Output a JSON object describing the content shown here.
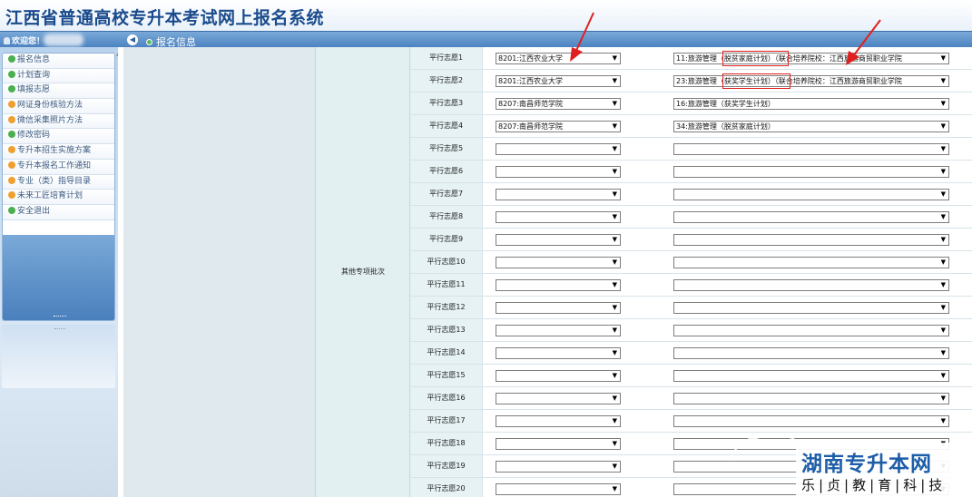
{
  "app": {
    "title": "江西省普通高校专升本考试网上报名系统"
  },
  "topbar": {
    "welcome": "欢迎您！",
    "breadcrumb": "报名信息"
  },
  "sidebar": {
    "items": [
      {
        "label": "报名信息",
        "icon_color": "#4caf50"
      },
      {
        "label": "计划查询",
        "icon_color": "#4caf50"
      },
      {
        "label": "填报志愿",
        "icon_color": "#4caf50"
      },
      {
        "label": "网证身份核验方法",
        "icon_color": "#f0a030"
      },
      {
        "label": "微信采集照片方法",
        "icon_color": "#f0a030"
      },
      {
        "label": "修改密码",
        "icon_color": "#4caf50"
      },
      {
        "label": "专升本招生实施方案",
        "icon_color": "#f0a030"
      },
      {
        "label": "专升本报名工作通知",
        "icon_color": "#f0a030"
      },
      {
        "label": "专业（类）指导目录",
        "icon_color": "#f0a030"
      },
      {
        "label": "未来工匠培育计划",
        "icon_color": "#f0a030"
      },
      {
        "label": "安全退出",
        "icon_color": "#4caf50"
      }
    ]
  },
  "form": {
    "batch_label": "其他专项批次",
    "choices": [
      {
        "label": "平行志愿1",
        "school": "8201:江西农业大学",
        "major": "11:旅游管理（脱贫家庭计划）（联合培养院校：江西旅游商贸职业学院"
      },
      {
        "label": "平行志愿2",
        "school": "8201:江西农业大学",
        "major": "23:旅游管理（获奖学生计划）（联合培养院校：江西旅游商贸职业学院"
      },
      {
        "label": "平行志愿3",
        "school": "8207:南昌师范学院",
        "major": "16:旅游管理（获奖学生计划）"
      },
      {
        "label": "平行志愿4",
        "school": "8207:南昌师范学院",
        "major": "34:旅游管理（脱贫家庭计划）"
      },
      {
        "label": "平行志愿5",
        "school": "",
        "major": ""
      },
      {
        "label": "平行志愿6",
        "school": "",
        "major": ""
      },
      {
        "label": "平行志愿7",
        "school": "",
        "major": ""
      },
      {
        "label": "平行志愿8",
        "school": "",
        "major": ""
      },
      {
        "label": "平行志愿9",
        "school": "",
        "major": ""
      },
      {
        "label": "平行志愿10",
        "school": "",
        "major": ""
      },
      {
        "label": "平行志愿11",
        "school": "",
        "major": ""
      },
      {
        "label": "平行志愿12",
        "school": "",
        "major": ""
      },
      {
        "label": "平行志愿13",
        "school": "",
        "major": ""
      },
      {
        "label": "平行志愿14",
        "school": "",
        "major": ""
      },
      {
        "label": "平行志愿15",
        "school": "",
        "major": ""
      },
      {
        "label": "平行志愿16",
        "school": "",
        "major": ""
      },
      {
        "label": "平行志愿17",
        "school": "",
        "major": ""
      },
      {
        "label": "平行志愿18",
        "school": "",
        "major": ""
      },
      {
        "label": "平行志愿19",
        "school": "",
        "major": ""
      },
      {
        "label": "平行志愿20",
        "school": "",
        "major": ""
      }
    ]
  },
  "watermark": {
    "brand": "湖南专升本网",
    "sub": "乐|贞|教|育|科|技"
  },
  "colors": {
    "title": "#1a4b8c",
    "bar": "#4c83c1",
    "annotation": "#e02020"
  }
}
